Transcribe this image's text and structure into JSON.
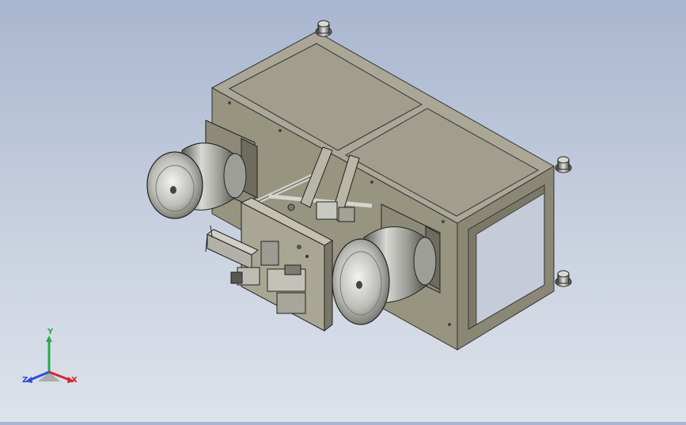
{
  "viewport": {
    "background_top": "#a8b6cf",
    "background_bottom": "#dde2ea",
    "model_color": "#a3a08f",
    "model_dark": "#6f6c60",
    "model_light": "#c9c6b6"
  },
  "triad": {
    "x_label": "X",
    "y_label": "Y",
    "z_label": "Z",
    "x_color": "#d4262a",
    "y_color": "#2aa84a",
    "z_color": "#2a4fd6"
  }
}
